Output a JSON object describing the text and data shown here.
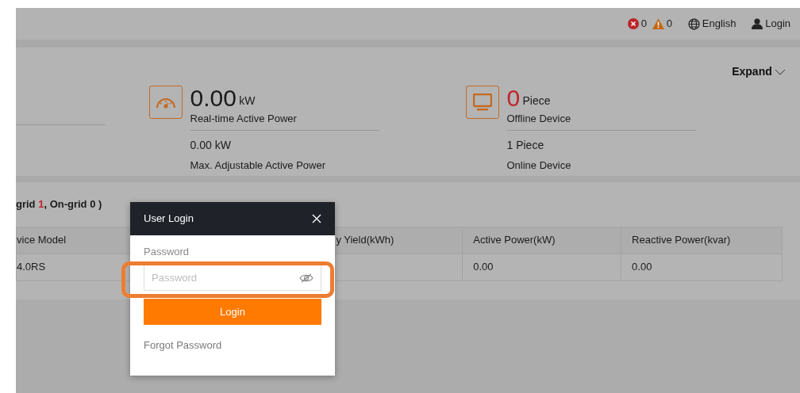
{
  "header": {
    "alerts": [
      {
        "kind": "error",
        "count": "0"
      },
      {
        "kind": "warning",
        "count": "0"
      }
    ],
    "language": "English",
    "login": "Login"
  },
  "summary": {
    "expand": "Expand",
    "cards": [
      {
        "kind": "gauge",
        "value": "0.00",
        "unit": "kW",
        "alert": false,
        "label": "Real-time Active Power",
        "secondary_value": "0.00 kW",
        "secondary_label": "Max. Adjustable Active Power"
      },
      {
        "kind": "monitor",
        "value": "0",
        "unit": "Piece",
        "alert": true,
        "label": "Offline Device",
        "secondary_value": "1 Piece",
        "secondary_label": "Online Device"
      }
    ]
  },
  "devices": {
    "heading_start": "grid ",
    "off_grid": "1",
    "heading_middle": ", On-grid ",
    "on_grid": "0",
    "heading_end": " )",
    "table": {
      "columns": [
        "vice Model",
        "",
        "y Yield(kWh)",
        "Active Power(kW)",
        "Reactive Power(kvar)"
      ],
      "rows": [
        [
          "4.0RS",
          "",
          "",
          "0.00",
          "0.00"
        ]
      ]
    }
  },
  "modal": {
    "title": "User Login",
    "password_label": "Password",
    "password": {
      "placeholder": "Password"
    },
    "submit": "Login",
    "forgot": "Forgot Password"
  },
  "annotation": {
    "kind": "highlight"
  }
}
